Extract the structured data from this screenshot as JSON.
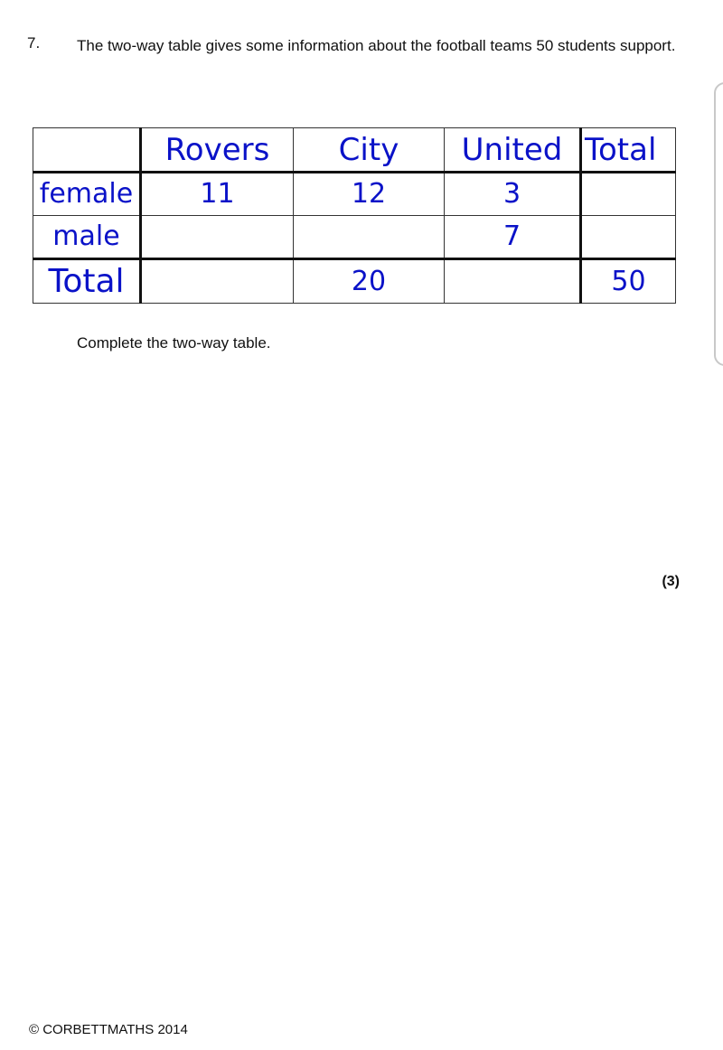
{
  "question": {
    "number": "7.",
    "text": "The two-way table gives some information about the football teams 50 students support."
  },
  "table": {
    "corner": "",
    "columns": [
      "Rovers",
      "City",
      "United",
      "Total"
    ],
    "rows": [
      {
        "label": "female",
        "cells": [
          "11",
          "12",
          "3",
          ""
        ]
      },
      {
        "label": "male",
        "cells": [
          "",
          "",
          "7",
          ""
        ]
      },
      {
        "label": "Total",
        "cells": [
          "",
          "20",
          "",
          "50"
        ]
      }
    ],
    "text_color": "#0a12c8"
  },
  "instruction": "Complete the two-way table.",
  "marks": "(3)",
  "footer": "© CORBETTMATHS 2014"
}
